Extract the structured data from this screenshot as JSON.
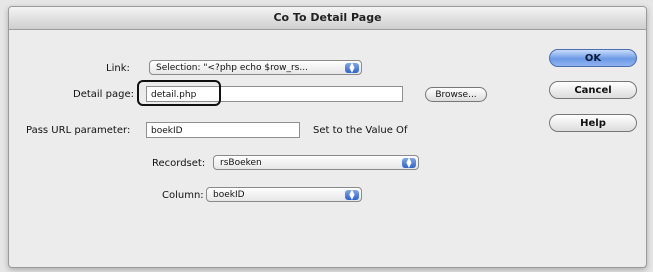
{
  "window": {
    "title": "Co To Detail Page"
  },
  "form": {
    "link_label": "Link:",
    "link_value": "Selection: \"<?php echo $row_rs...",
    "detail_page_label": "Detail page:",
    "detail_page_value": "detail.php",
    "browse_label": "Browse...",
    "pass_url_label": "Pass URL parameter:",
    "pass_url_value": "boekID",
    "set_value_label": "Set to the Value Of",
    "recordset_label": "Recordset:",
    "recordset_value": "rsBoeken",
    "column_label": "Column:",
    "column_value": "boekID"
  },
  "buttons": {
    "ok": "OK",
    "cancel": "Cancel",
    "help": "Help"
  },
  "icons": {
    "dropdown": "updown-arrows-icon"
  },
  "colors": {
    "default_button": "#6b9ae6",
    "dropdown_arrow": "#2f63cf"
  }
}
